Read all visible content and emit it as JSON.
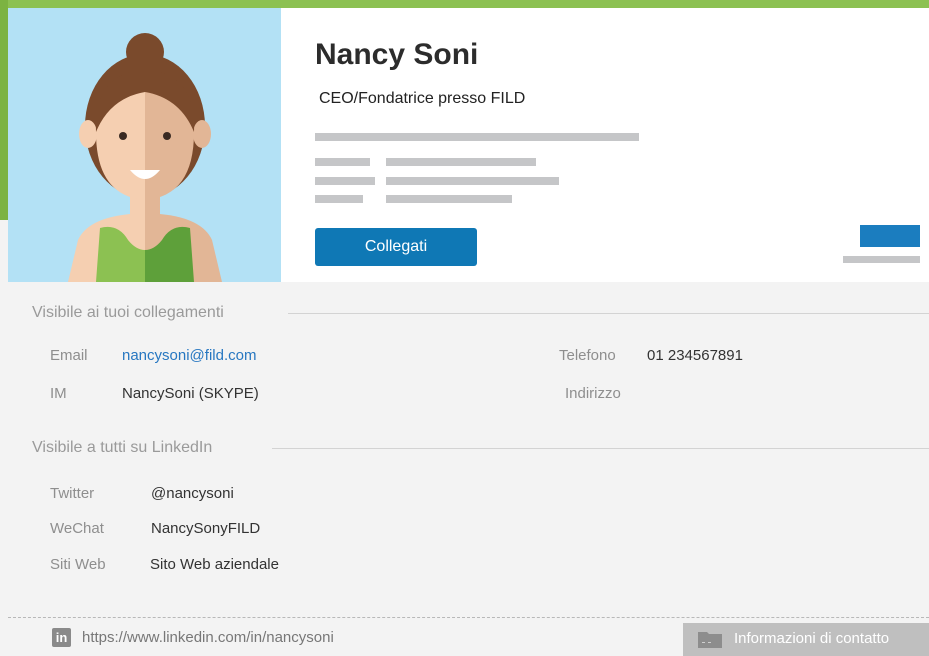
{
  "profile": {
    "name": "Nancy Soni",
    "headline": "CEO/Fondatrice presso FILD",
    "connect_label": "Collegati"
  },
  "sections": {
    "connections_title": "Visibile ai tuoi collegamenti",
    "public_title": "Visibile a tutti su LinkedIn"
  },
  "connections": {
    "email_label": "Email",
    "email_value": "nancysoni@fild.com",
    "im_label": "IM",
    "im_value": "NancySoni (SKYPE)",
    "phone_label": "Telefono",
    "phone_value": "01 234567891",
    "address_label": "Indirizzo"
  },
  "public": {
    "twitter_label": "Twitter",
    "twitter_value": "@nancysoni",
    "wechat_label": "WeChat",
    "wechat_value": "NancySonyFILD",
    "sites_label": "Siti Web",
    "sites_value": "Sito Web aziendale"
  },
  "footer": {
    "linkedin_glyph": "in",
    "url": "https://www.linkedin.com/in/nancysoni",
    "contact_label": "Informazioni di contatto"
  },
  "colors": {
    "accent_green": "#8cc152",
    "avatar_bg": "#b3e1f5",
    "primary_blue": "#0f78b5",
    "link_blue": "#2777c1"
  }
}
